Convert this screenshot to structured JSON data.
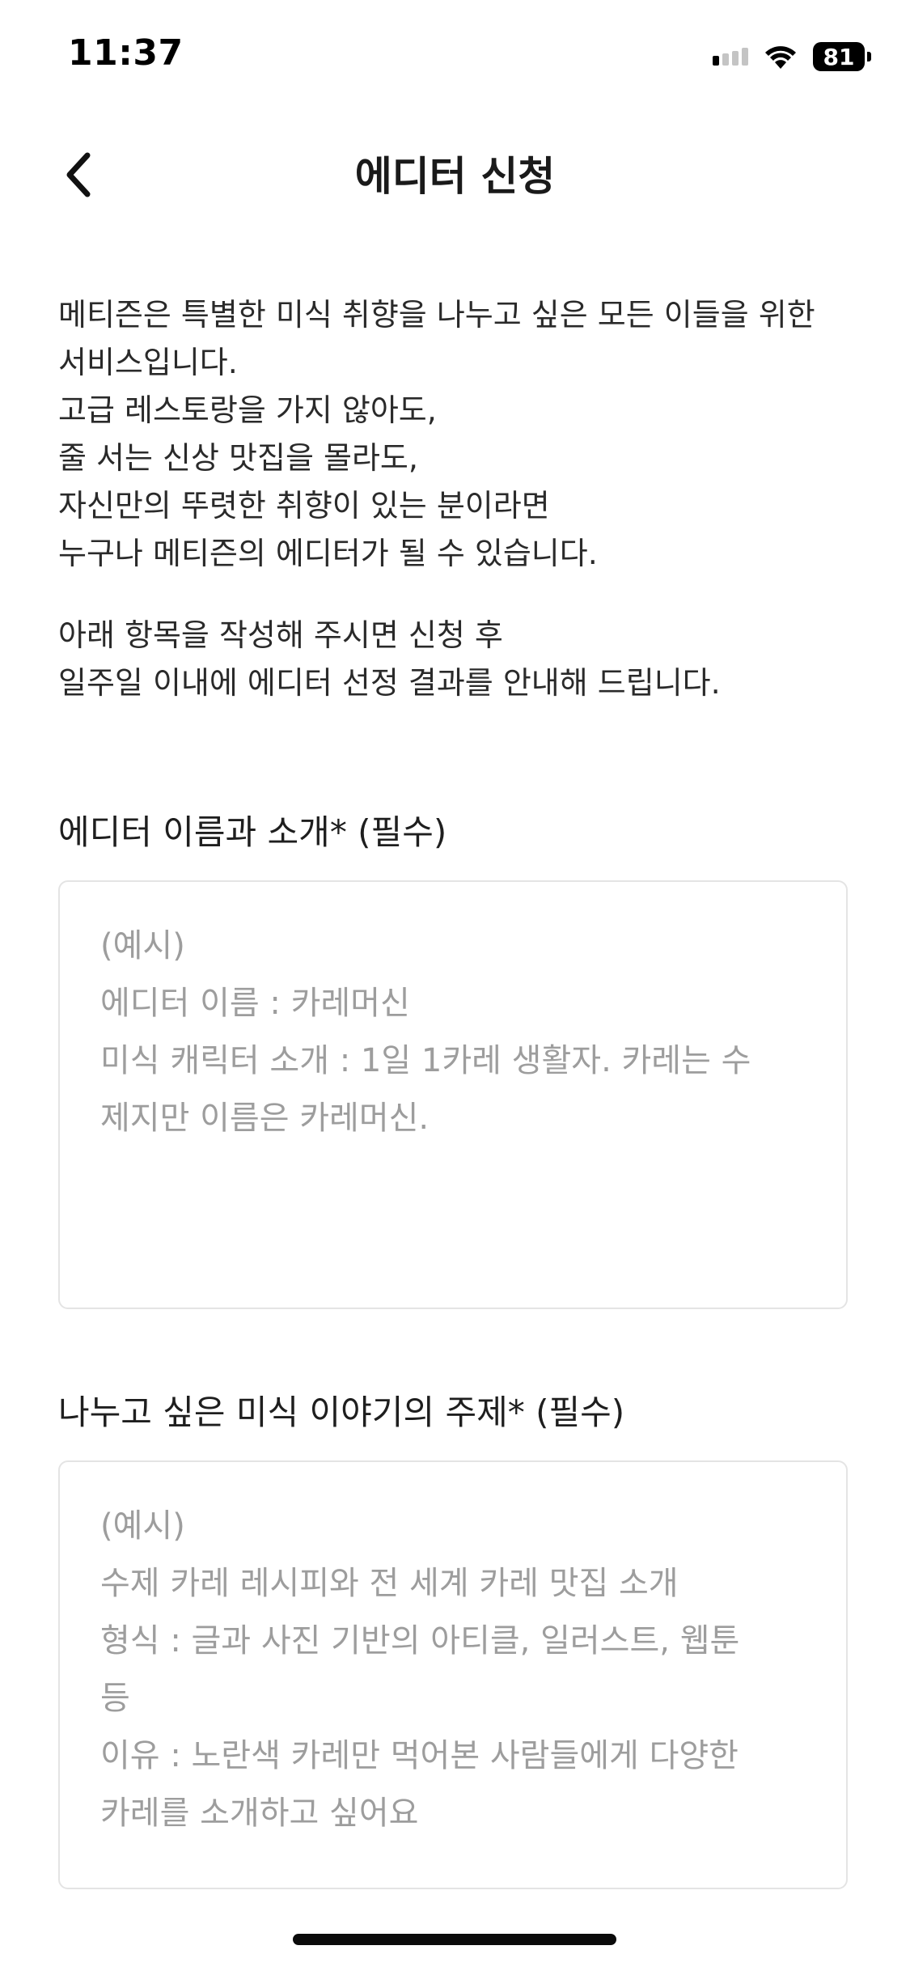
{
  "status_bar": {
    "time": "11:37",
    "battery": "81",
    "icons": [
      "signal-icon",
      "wifi-icon",
      "battery-icon"
    ]
  },
  "header": {
    "title": "에디터 신청",
    "back_icon": "chevron-left-icon"
  },
  "intro": {
    "lines": [
      "메티즌은 특별한 미식 취향을 나누고 싶은 모든 이들을 위한",
      "서비스입니다.",
      "고급 레스토랑을 가지 않아도,",
      "줄 서는 신상 맛집을 몰라도,",
      "자신만의 뚜렷한 취향이 있는 분이라면",
      "누구나 메티즌의 에디터가 될 수 있습니다."
    ],
    "lines2": [
      "아래 항목을 작성해 주시면 신청 후",
      "일주일 이내에 에디터 선정 결과를 안내해 드립니다."
    ]
  },
  "form": {
    "editor_intro": {
      "label": "에디터 이름과 소개* (필수)",
      "placeholder_lines": [
        "(예시)",
        "에디터 이름 : 카레머신",
        "미식 캐릭터 소개 : 1일 1카레 생활자. 카레는 수",
        "제지만 이름은 카레머신."
      ]
    },
    "topic": {
      "label": "나누고 싶은 미식 이야기의 주제* (필수)",
      "placeholder_lines": [
        "(예시)",
        "수제 카레 레시피와 전 세계 카레 맛집 소개",
        "형식 : 글과 사진 기반의 아티클, 일러스트, 웹툰",
        "등",
        "이유 : 노란색 카레만 먹어본 사람들에게 다양한",
        "카레를 소개하고 싶어요"
      ]
    }
  },
  "colors": {
    "text": "#1c1c1c",
    "placeholder": "#9d9d9d",
    "border": "#e4e4e4",
    "background": "#ffffff"
  }
}
